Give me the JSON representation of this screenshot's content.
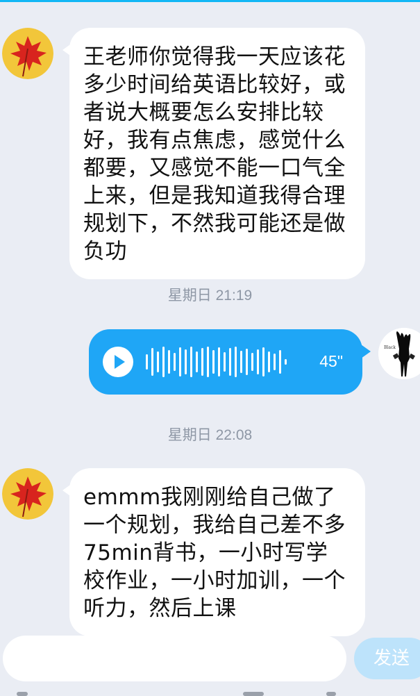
{
  "messages": [
    {
      "text": "王老师你觉得我一天应该花多少时间给英语比较好，或者说大概要怎么安排比较好，我有点焦虑，感觉什么都要，又感觉不能一口气全上来，但是我知道我得合理规划下，不然我可能还是做负功"
    },
    {
      "duration": "45\""
    },
    {
      "text": "emmm我刚刚给自己做了一个规划，我给自己差不多75min背书，一小时写学校作业，一小时加训，一个听力，然后上课"
    }
  ],
  "timestamps": [
    "星期日 21:19",
    "星期日 22:08"
  ],
  "input": {
    "placeholder": ""
  },
  "send_label": "发送",
  "colors": {
    "background": "#eaedf4",
    "voice_bubble": "#1fa6f6",
    "send_button": "#bde3fb",
    "timestamp_text": "#8e97a5"
  },
  "icons": [
    "maple-leaf-avatar",
    "play-icon",
    "black-figure-avatar"
  ]
}
